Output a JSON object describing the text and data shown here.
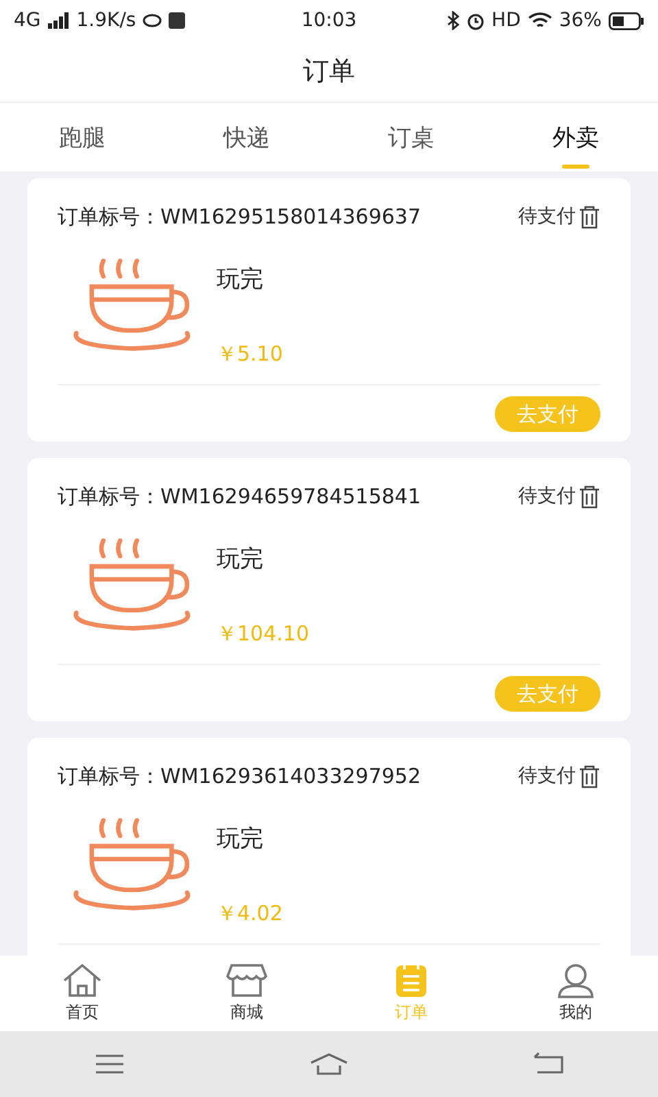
{
  "status_bar": {
    "network": "4G",
    "speed": "1.9K/s",
    "time": "10:03",
    "hd": "HD",
    "battery": "36%"
  },
  "header": {
    "title": "订单"
  },
  "tabs": [
    {
      "label": "跑腿",
      "selected": false
    },
    {
      "label": "快递",
      "selected": false
    },
    {
      "label": "订桌",
      "selected": false
    },
    {
      "label": "外卖",
      "selected": true
    }
  ],
  "orders": [
    {
      "number_label": "订单标号：WM16295158014369637",
      "status": "待支付",
      "name": "玩完",
      "price": "￥5.10",
      "button": "去支付"
    },
    {
      "number_label": "订单标号：WM16294659784515841",
      "status": "待支付",
      "name": "玩完",
      "price": "￥104.10",
      "button": "去支付"
    },
    {
      "number_label": "订单标号：WM16293614033297952",
      "status": "待支付",
      "name": "玩完",
      "price": "￥4.02"
    }
  ],
  "bottom_nav": [
    {
      "label": "首页",
      "selected": false
    },
    {
      "label": "商城",
      "selected": false
    },
    {
      "label": "订单",
      "selected": true
    },
    {
      "label": "我的",
      "selected": false
    }
  ]
}
